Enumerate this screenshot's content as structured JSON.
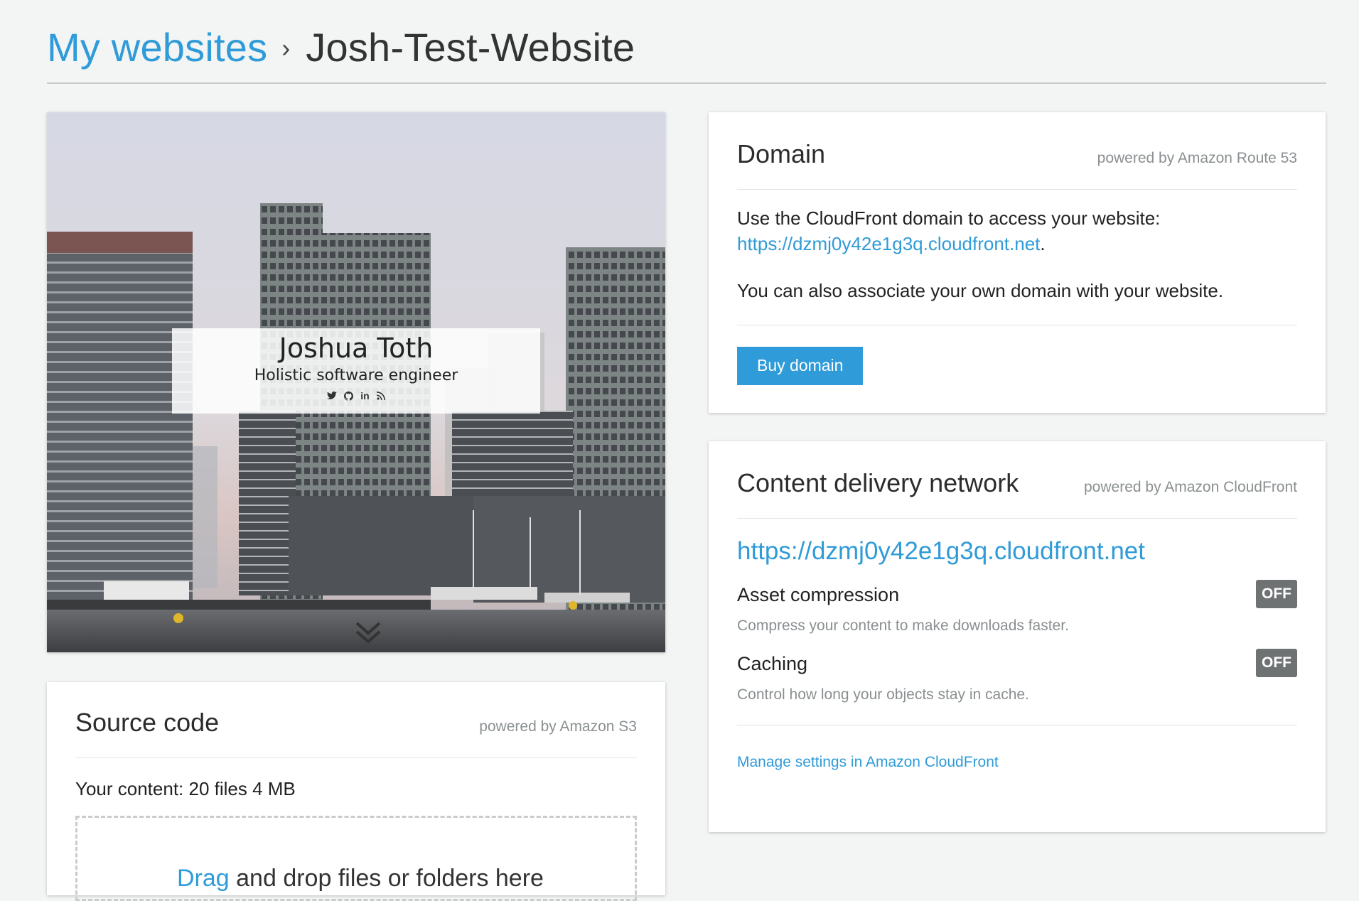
{
  "breadcrumb": {
    "root_label": "My websites",
    "separator": "›",
    "current_label": "Josh-Test-Website"
  },
  "preview": {
    "name": "Joshua Toth",
    "subtitle": "Holistic software engineer",
    "social_icons": [
      "twitter-icon",
      "github-icon",
      "linkedin-icon",
      "rss-icon"
    ],
    "social_glyphs": {
      "twitter": "🐦",
      "github": "◉",
      "linkedin": "in",
      "rss": "≈"
    }
  },
  "source_code": {
    "title": "Source code",
    "powered_by": "powered by Amazon S3",
    "content_label": "Your content: 20 files 4 MB",
    "dropzone_link": "Drag",
    "dropzone_text": " and drop files or folders here"
  },
  "domain": {
    "title": "Domain",
    "powered_by": "powered by Amazon Route 53",
    "intro": "Use the CloudFront domain to access your website:",
    "cloudfront_url": "https://dzmj0y42e1g3q.cloudfront.net",
    "period": ".",
    "associate_text": "You can also associate your own domain with your website.",
    "buy_button": "Buy domain"
  },
  "cdn": {
    "title": "Content delivery network",
    "powered_by": "powered by Amazon CloudFront",
    "url": "https://dzmj0y42e1g3q.cloudfront.net",
    "settings": [
      {
        "title": "Asset compression",
        "description": "Compress your content to make downloads faster.",
        "state": "OFF"
      },
      {
        "title": "Caching",
        "description": "Control how long your objects stay in cache.",
        "state": "OFF"
      }
    ],
    "manage_link": "Manage settings in Amazon CloudFront"
  },
  "colors": {
    "accent": "#2f9bd8",
    "page_background": "#f3f4f4",
    "toggle_off": "#6f7273"
  }
}
